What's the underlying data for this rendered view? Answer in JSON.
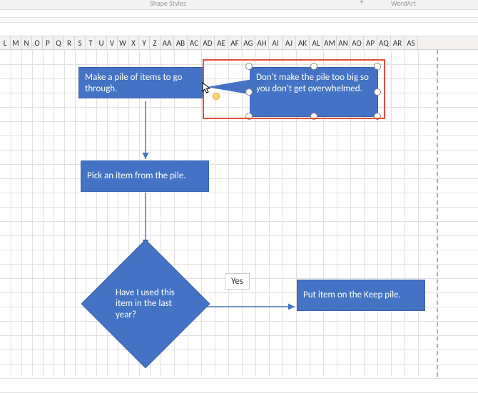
{
  "ribbon": {
    "styles_group": "Shape Styles",
    "launcher_glyph": "▾",
    "wordart_group": "WordArt"
  },
  "columns": [
    "L",
    "M",
    "N",
    "O",
    "P",
    "Q",
    "R",
    "S",
    "T",
    "U",
    "V",
    "W",
    "X",
    "Y",
    "Z",
    "AA",
    "AB",
    "AC",
    "AD",
    "AE",
    "AF",
    "AG",
    "AH",
    "AI",
    "AJ",
    "AK",
    "AL",
    "AM",
    "AN",
    "AO",
    "AP",
    "AQ",
    "AR",
    "AS"
  ],
  "col_widths_single": 15,
  "col_widths_double": 19,
  "flow": {
    "step1": "Make a pile of items to go through.",
    "step2": "Pick an item from the pile.",
    "decision": "Have I used this item in the last year?",
    "yes_label": "Yes",
    "keep": "Put item on the Keep pile."
  },
  "callout": {
    "text": "Don't make the pile too big so you don't get overwhelmed."
  },
  "chart_data": {
    "type": "flowchart",
    "nodes": [
      {
        "id": "start",
        "shape": "process",
        "text": "Make a pile of items to go through."
      },
      {
        "id": "pick",
        "shape": "process",
        "text": "Pick an item from the pile."
      },
      {
        "id": "used",
        "shape": "decision",
        "text": "Have I used this item in the last year?"
      },
      {
        "id": "keep",
        "shape": "process",
        "text": "Put item on the Keep pile."
      },
      {
        "id": "note",
        "shape": "callout",
        "text": "Don't make the pile too big so you don't get overwhelmed.",
        "attached_to": "start"
      }
    ],
    "edges": [
      {
        "from": "start",
        "to": "pick"
      },
      {
        "from": "pick",
        "to": "used"
      },
      {
        "from": "used",
        "to": "keep",
        "label": "Yes"
      }
    ]
  }
}
